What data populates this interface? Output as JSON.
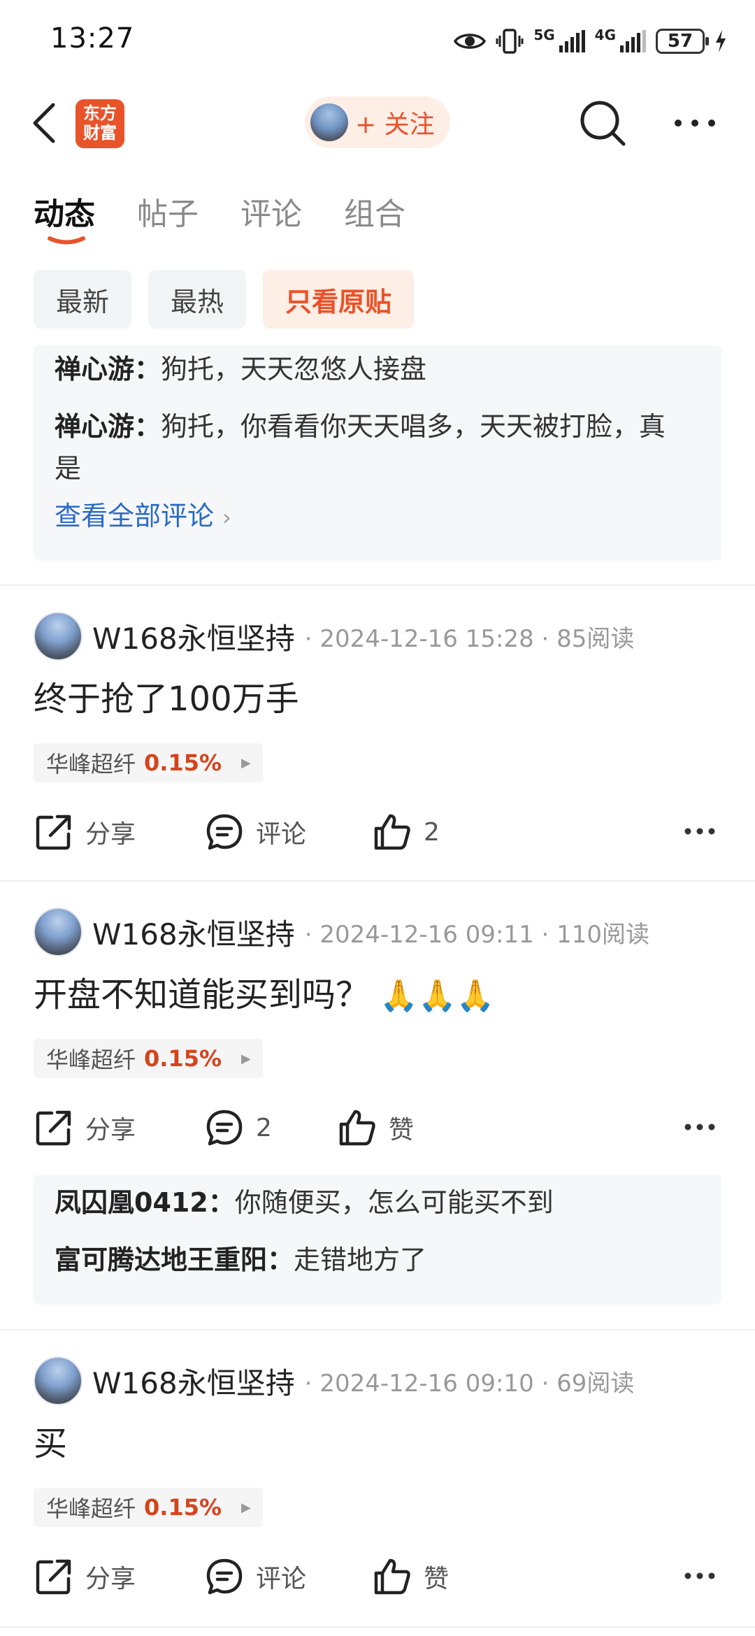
{
  "status_bar": {
    "time": "13:27",
    "signal_5g": "5G",
    "signal_4g": "4G",
    "battery": "57"
  },
  "header": {
    "logo_line1": "东方",
    "logo_line2": "财富",
    "follow_label": "+ 关注",
    "colors": {
      "brand": "#e9532a",
      "brand_bg": "#fdeee6"
    }
  },
  "tabs": [
    {
      "label": "动态",
      "active": true
    },
    {
      "label": "帖子",
      "active": false
    },
    {
      "label": "评论",
      "active": false
    },
    {
      "label": "组合",
      "active": false
    }
  ],
  "filters": [
    {
      "label": "最新",
      "active": false
    },
    {
      "label": "最热",
      "active": false
    },
    {
      "label": "只看原贴",
      "active": true
    }
  ],
  "top_comments": {
    "lines": [
      {
        "user": "禅心游",
        "sep": "：",
        "text": "狗托，天天忽悠人接盘"
      },
      {
        "user": "禅心游",
        "sep": "：",
        "text": "狗托，你看看你天天唱多，天天被打脸，真是"
      }
    ],
    "view_all": "查看全部评论"
  },
  "posts": [
    {
      "author": "W168永恒坚持",
      "meta": "· 2024-12-16 15:28 · 85阅读",
      "text": "终于抢了100万手",
      "emoji": "",
      "stock_name": "华峰超纤",
      "stock_pct": "0.15%",
      "share": "分享",
      "comment": "评论",
      "like": "2",
      "comments": []
    },
    {
      "author": "W168永恒坚持",
      "meta": "· 2024-12-16 09:11 · 110阅读",
      "text": "开盘不知道能买到吗？",
      "emoji": "🙏🙏🙏",
      "stock_name": "华峰超纤",
      "stock_pct": "0.15%",
      "share": "分享",
      "comment": "2",
      "like": "赞",
      "comments": [
        {
          "user": "凤囚凰0412",
          "sep": "：",
          "text": "你随便买，怎么可能买不到"
        },
        {
          "user": "富可腾达地王重阳",
          "sep": "：",
          "text": "走错地方了"
        }
      ]
    },
    {
      "author": "W168永恒坚持",
      "meta": "· 2024-12-16 09:10 · 69阅读",
      "text": "买",
      "emoji": "",
      "stock_name": "华峰超纤",
      "stock_pct": "0.15%",
      "share": "分享",
      "comment": "评论",
      "like": "赞",
      "comments": []
    }
  ],
  "icons": {
    "back": "chevron-left-icon",
    "search": "search-icon",
    "more": "more-horizontal-icon",
    "share": "share-icon",
    "comment": "comment-icon",
    "like": "thumbs-up-icon"
  }
}
